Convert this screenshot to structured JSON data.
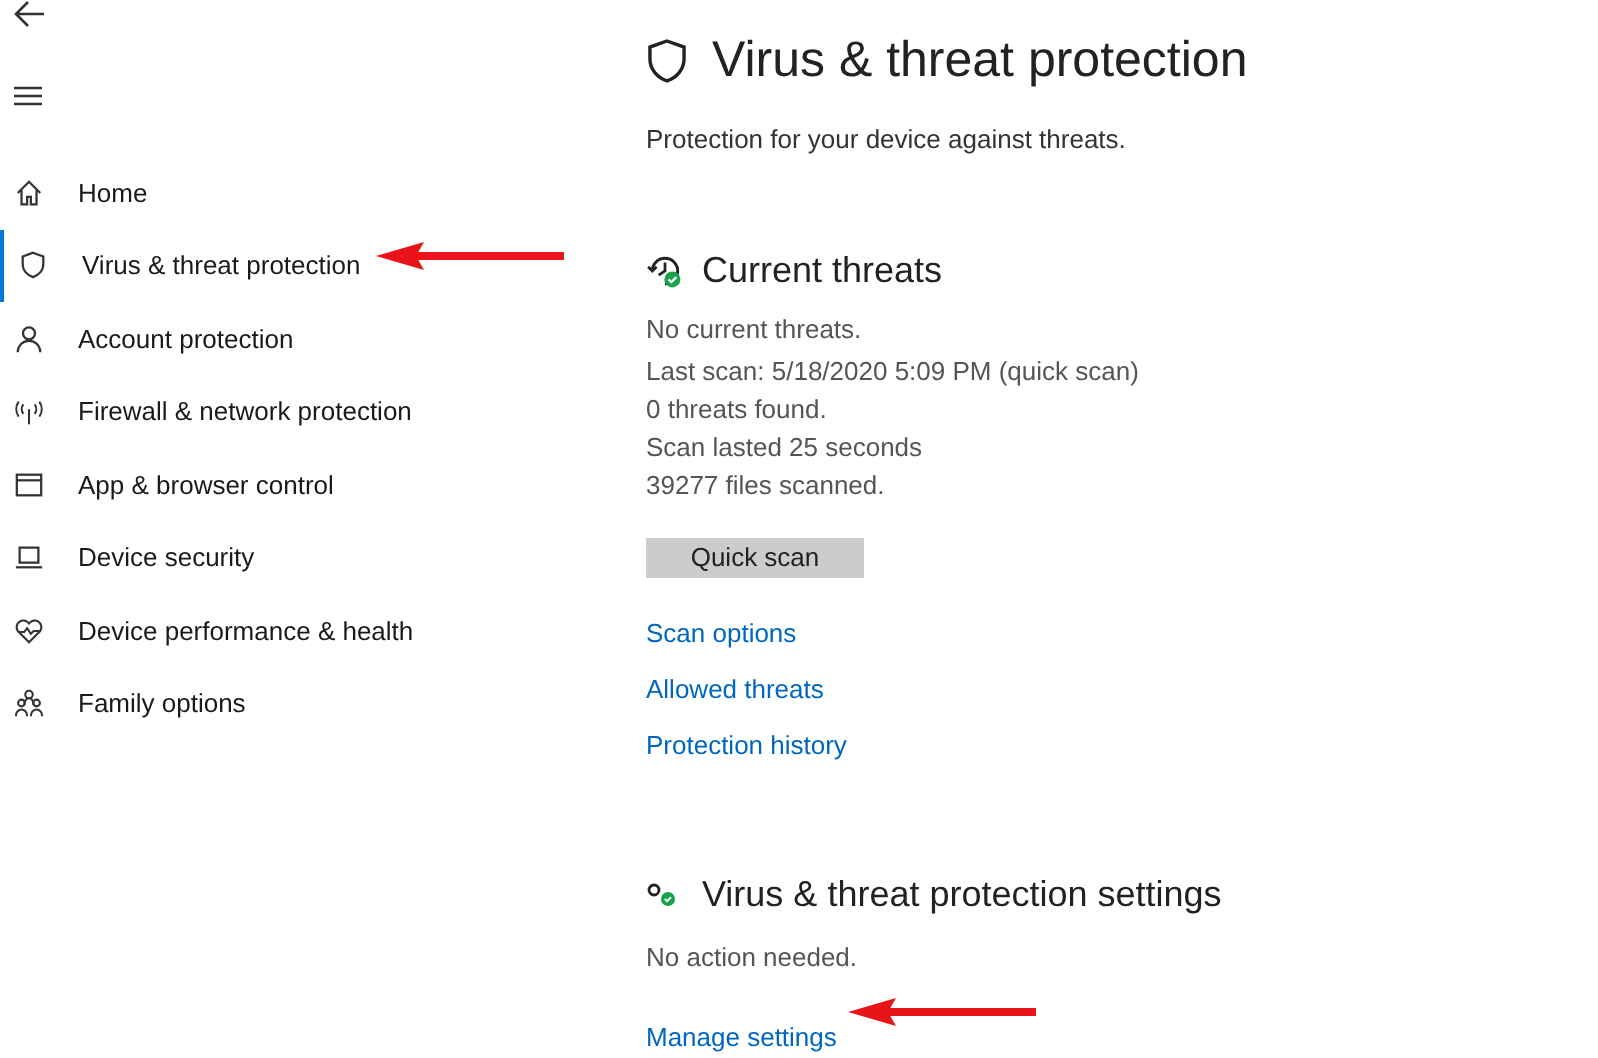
{
  "nav": {
    "items": [
      {
        "label": "Home",
        "selected": false
      },
      {
        "label": "Virus & threat protection",
        "selected": true
      },
      {
        "label": "Account protection",
        "selected": false
      },
      {
        "label": "Firewall & network protection",
        "selected": false
      },
      {
        "label": "App & browser control",
        "selected": false
      },
      {
        "label": "Device security",
        "selected": false
      },
      {
        "label": "Device performance & health",
        "selected": false
      },
      {
        "label": "Family options",
        "selected": false
      }
    ]
  },
  "page": {
    "title": "Virus & threat protection",
    "subtitle": "Protection for your device against threats."
  },
  "current_threats": {
    "heading": "Current threats",
    "lines": [
      "No current threats.",
      "Last scan: 5/18/2020 5:09 PM (quick scan)",
      "0 threats found.",
      "Scan lasted 25 seconds",
      "39277 files scanned."
    ],
    "button": "Quick scan",
    "links": [
      "Scan options",
      "Allowed threats",
      "Protection history"
    ]
  },
  "settings": {
    "heading": "Virus & threat protection settings",
    "status": "No action needed.",
    "link": "Manage settings"
  }
}
